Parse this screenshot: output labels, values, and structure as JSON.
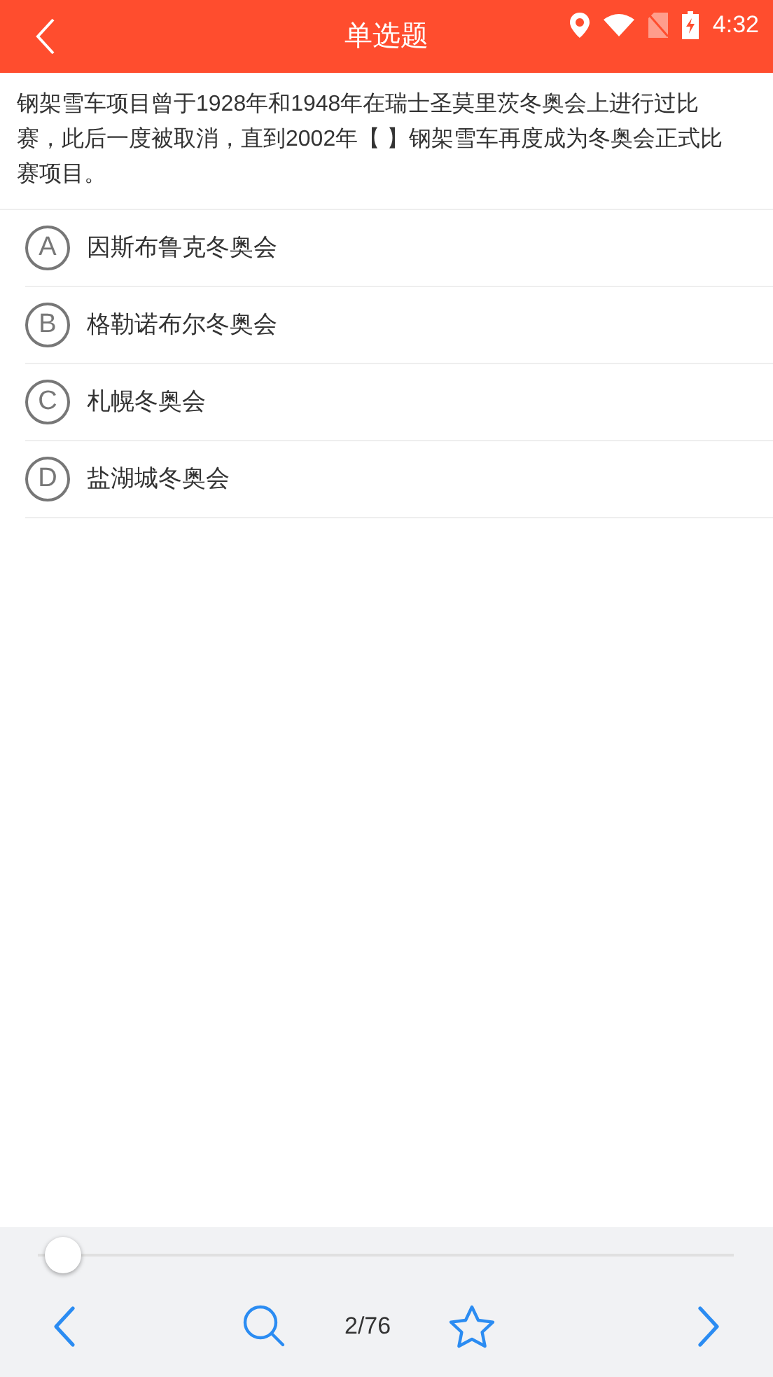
{
  "status_bar": {
    "time": "4:32"
  },
  "header": {
    "title": "单选题"
  },
  "question": {
    "text": "钢架雪车项目曾于1928年和1948年在瑞士圣莫里茨冬奥会上进行过比赛，此后一度被取消，直到2002年【 】钢架雪车再度成为冬奥会正式比赛项目。"
  },
  "options": [
    {
      "letter": "A",
      "text": "因斯布鲁克冬奥会",
      "selected": false
    },
    {
      "letter": "B",
      "text": "格勒诺布尔冬奥会",
      "selected": false
    },
    {
      "letter": "C",
      "text": "札幌冬奥会",
      "selected": false
    },
    {
      "letter": "D",
      "text": "盐湖城冬奥会",
      "selected": false
    }
  ],
  "footer": {
    "progress": {
      "level": 0.01
    },
    "counter": "2/76",
    "favorited": false
  }
}
